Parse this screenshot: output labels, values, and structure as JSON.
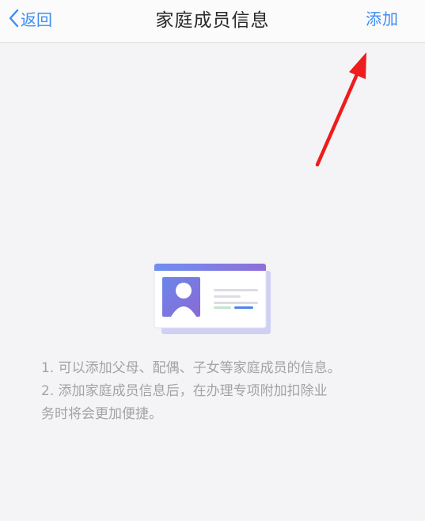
{
  "navbar": {
    "back_label": "返回",
    "title": "家庭成员信息",
    "add_label": "添加"
  },
  "tips": {
    "line1": "1. 可以添加父母、配偶、子女等家庭成员的信息。",
    "line2": "2. 添加家庭成员信息后，在办理专项附加扣除业",
    "line3": "务时将会更加便捷。"
  },
  "colors": {
    "accent": "#3d8df5",
    "annotation_arrow": "#ee1c1c",
    "tip_text": "#a3a3a7"
  },
  "icons": {
    "back": "chevron-left-icon",
    "illustration": "id-card-icon"
  }
}
